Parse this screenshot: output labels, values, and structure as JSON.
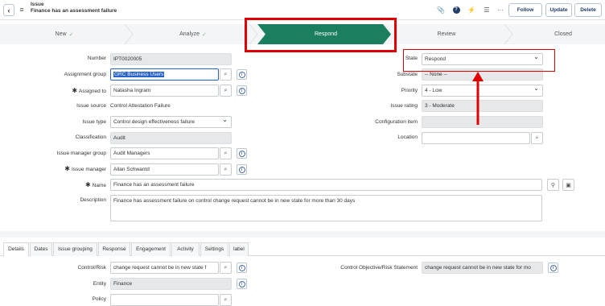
{
  "header": {
    "record_type": "Issue",
    "record_title": "Finance has an assessment failure",
    "follow_label": "Follow",
    "update_label": "Update",
    "delete_label": "Delete"
  },
  "stepper": {
    "steps": [
      {
        "label": "New",
        "done": true
      },
      {
        "label": "Analyze",
        "done": true
      },
      {
        "label": "Respond",
        "active": true
      },
      {
        "label": "Review"
      },
      {
        "label": "Closed"
      }
    ]
  },
  "form": {
    "number": {
      "label": "Number",
      "value": "IPT0020005"
    },
    "assignment_group": {
      "label": "Assignment group",
      "value": "GRC Business Users"
    },
    "assigned_to": {
      "label": "Assigned to",
      "value": "Natasha Ingram"
    },
    "issue_source": {
      "label": "Issue source",
      "value": "Control Attestation Failure"
    },
    "issue_type": {
      "label": "Issue type",
      "value": "Control design effectiveness failure"
    },
    "classification": {
      "label": "Classification",
      "value": "Audit"
    },
    "issue_manager_group": {
      "label": "Issue manager group",
      "value": "Audit Managers"
    },
    "issue_manager": {
      "label": "Issue manager",
      "value": "Allan Schwantd"
    },
    "name": {
      "label": "Name",
      "value": "Finance has an assessment failure"
    },
    "description": {
      "label": "Description",
      "value": "Finance has assessment failure on control change request cannot be in new state for more than 30 days"
    },
    "state": {
      "label": "State",
      "value": "Respond"
    },
    "substate": {
      "label": "Substate",
      "value": "-- None --"
    },
    "priority": {
      "label": "Priority",
      "value": "4 - Low"
    },
    "issue_rating": {
      "label": "Issue rating",
      "value": "3 - Moderate"
    },
    "configuration_item": {
      "label": "Configuration item",
      "value": ""
    },
    "location": {
      "label": "Location",
      "value": ""
    }
  },
  "tabs": [
    "Details",
    "Dates",
    "Issue grouping",
    "Response",
    "Engagement",
    "Activity",
    "Settings",
    "label"
  ],
  "details": {
    "control_risk": {
      "label": "Control/Risk",
      "value": "change request cannot be in new state f"
    },
    "entity": {
      "label": "Entity",
      "value": "Finance"
    },
    "policy": {
      "label": "Policy",
      "value": ""
    },
    "control_objective": {
      "label": "Control Objective/Risk Statement",
      "value": "change request cannot be in new state for mo"
    }
  },
  "colors": {
    "accent": "#1b7f5f",
    "annotation": "#e00000",
    "selection": "#2563c9"
  }
}
